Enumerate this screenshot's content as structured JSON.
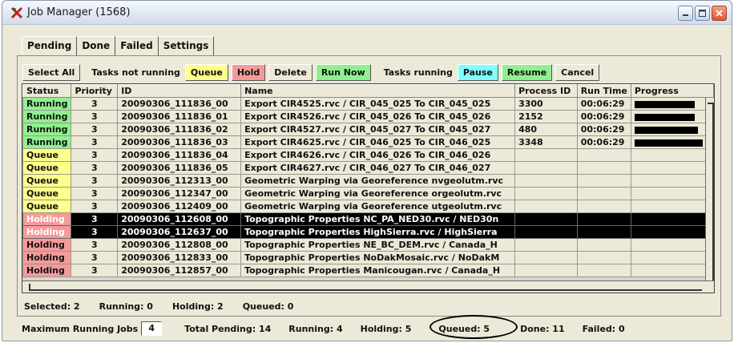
{
  "window": {
    "title": "Job Manager (1568)"
  },
  "tabs": [
    "Pending",
    "Done",
    "Failed",
    "Settings"
  ],
  "toolbar": {
    "select_all": "Select All",
    "tasks_not_running": "Tasks not running",
    "queue": "Queue",
    "hold": "Hold",
    "delete": "Delete",
    "run_now": "Run Now",
    "tasks_running": "Tasks running",
    "pause": "Pause",
    "resume": "Resume",
    "cancel": "Cancel"
  },
  "table": {
    "headers": [
      "Status",
      "Priority",
      "ID",
      "Name",
      "Process ID",
      "Run Time",
      "Progress"
    ],
    "rows": [
      {
        "status": "Running",
        "priority": "3",
        "id": "20090306_111836_00",
        "name": "Export CIR4525.rvc / CIR_045_025 To CIR_045_025",
        "pid": "3300",
        "runtime": "00:06:29",
        "progress": 0.8,
        "selected": false
      },
      {
        "status": "Running",
        "priority": "3",
        "id": "20090306_111836_01",
        "name": "Export CIR4526.rvc / CIR_045_026 To CIR_045_026",
        "pid": "2152",
        "runtime": "00:06:29",
        "progress": 0.8,
        "selected": false
      },
      {
        "status": "Running",
        "priority": "3",
        "id": "20090306_111836_02",
        "name": "Export CIR4527.rvc / CIR_045_027 To CIR_045_027",
        "pid": "480",
        "runtime": "00:06:29",
        "progress": 0.84,
        "selected": false
      },
      {
        "status": "Running",
        "priority": "3",
        "id": "20090306_111836_03",
        "name": "Export CIR4625.rvc / CIR_046_025 To CIR_046_025",
        "pid": "3348",
        "runtime": "00:06:29",
        "progress": 0.9,
        "selected": false
      },
      {
        "status": "Queue",
        "priority": "3",
        "id": "20090306_111836_04",
        "name": "Export CIR4626.rvc / CIR_046_026 To CIR_046_026",
        "pid": "",
        "runtime": "",
        "progress": null,
        "selected": false
      },
      {
        "status": "Queue",
        "priority": "3",
        "id": "20090306_111836_05",
        "name": "Export CIR4627.rvc / CIR_046_027 To CIR_046_027",
        "pid": "",
        "runtime": "",
        "progress": null,
        "selected": false
      },
      {
        "status": "Queue",
        "priority": "3",
        "id": "20090306_112313_00",
        "name": "Geometric Warping via Georeference nvgeolutm.rvc",
        "pid": "",
        "runtime": "",
        "progress": null,
        "selected": false
      },
      {
        "status": "Queue",
        "priority": "3",
        "id": "20090306_112347_00",
        "name": "Geometric Warping via Georeference orgeolutm.rvc",
        "pid": "",
        "runtime": "",
        "progress": null,
        "selected": false
      },
      {
        "status": "Queue",
        "priority": "3",
        "id": "20090306_112409_00",
        "name": "Geometric Warping via Georeference utgeolutm.rvc",
        "pid": "",
        "runtime": "",
        "progress": null,
        "selected": false
      },
      {
        "status": "Holding",
        "priority": "3",
        "id": "20090306_112608_00",
        "name": "Topographic Properties NC_PA_NED30.rvc / NED30n",
        "pid": "",
        "runtime": "",
        "progress": null,
        "selected": true
      },
      {
        "status": "Holding",
        "priority": "3",
        "id": "20090306_112637_00",
        "name": "Topographic Properties HighSierra.rvc / HighSierra",
        "pid": "",
        "runtime": "",
        "progress": null,
        "selected": true
      },
      {
        "status": "Holding",
        "priority": "3",
        "id": "20090306_112808_00",
        "name": "Topographic Properties NE_BC_DEM.rvc / Canada_H",
        "pid": "",
        "runtime": "",
        "progress": null,
        "selected": false
      },
      {
        "status": "Holding",
        "priority": "3",
        "id": "20090306_112833_00",
        "name": "Topographic Properties NoDakMosaic.rvc / NoDakM",
        "pid": "",
        "runtime": "",
        "progress": null,
        "selected": false
      },
      {
        "status": "Holding",
        "priority": "3",
        "id": "20090306_112857_00",
        "name": "Topographic Properties Manicougan.rvc / Canada_H",
        "pid": "",
        "runtime": "",
        "progress": null,
        "selected": false
      }
    ]
  },
  "selection_stats": {
    "selected": "Selected: 2",
    "running": "Running: 0",
    "holding": "Holding: 2",
    "queued": "Queued: 0"
  },
  "footer": {
    "max_running_label": "Maximum Running Jobs",
    "max_running_value": "4",
    "total_pending": "Total Pending: 14",
    "running": "Running: 4",
    "holding": "Holding: 5",
    "queued": "Queued: 5",
    "done": "Done: 11",
    "failed": "Failed: 0"
  },
  "colors": {
    "running": "#8ff08f",
    "queue": "#ffff8c",
    "holding": "#f59a9a",
    "pause": "#80ffff",
    "selected_row": "#000000"
  },
  "icons": [
    "job-manager-app-icon",
    "minimize-icon",
    "maximize-icon",
    "close-icon"
  ]
}
